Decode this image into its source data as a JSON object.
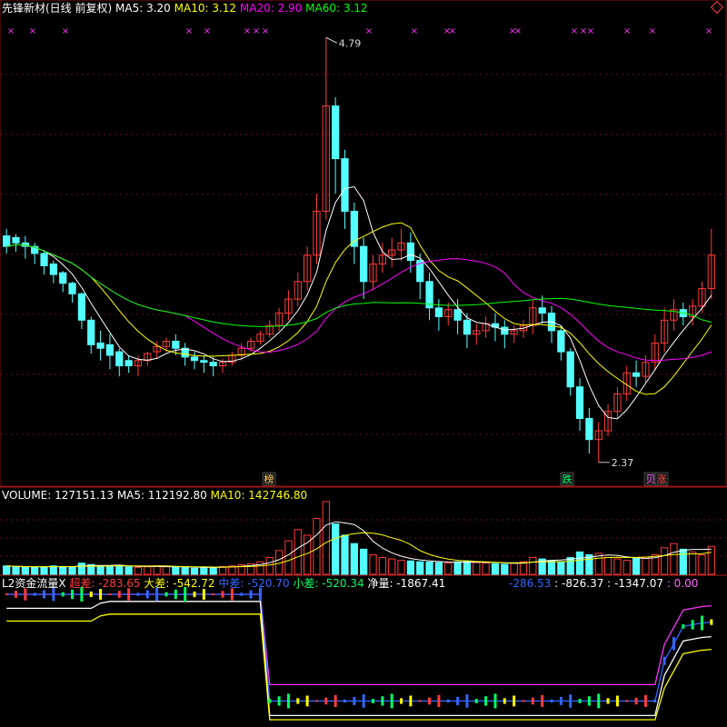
{
  "price_panel": {
    "stock_name": "先锋新材(日线 前复权)",
    "ma_labels": [
      {
        "text": "MA5: 3.20",
        "color": "#ffffff"
      },
      {
        "text": "MA10: 3.12",
        "color": "#ffff00"
      },
      {
        "text": "MA20: 2.90",
        "color": "#ff00ff"
      },
      {
        "text": "MA60: 3.12",
        "color": "#00ff00"
      }
    ],
    "high_label": "4.79",
    "low_label": "2.37",
    "tags": [
      {
        "text": "榜",
        "color": "#ffcc66"
      },
      {
        "text": "跌",
        "color": "#00ff66"
      },
      {
        "text": "贝",
        "color": "#ff66ff"
      },
      {
        "text": "涨",
        "color": "#ff4444"
      }
    ],
    "up_color": "#ff3b3b",
    "down_color": "#54ffff",
    "marker_icon": "x-mark-icon",
    "marker_color": "#ff33ff"
  },
  "volume_panel": {
    "title": "VOLUME: 127151.13",
    "ma_labels": [
      {
        "text": "MA5: 112192.80",
        "color": "#ffffff"
      },
      {
        "text": "MA10: 142746.80",
        "color": "#ffff00"
      }
    ]
  },
  "flow_panel": {
    "title": "L2资金流量X",
    "labels": [
      {
        "text": "超差: -283.65",
        "color": "#ff3b3b"
      },
      {
        "text": "大差: -542.72",
        "color": "#ffff00"
      },
      {
        "text": "中差: -520.70",
        "color": "#3366ff"
      },
      {
        "text": "小差: -520.34",
        "color": "#00ff66"
      },
      {
        "text": "净量: -1867.41",
        "color": "#ffffff"
      }
    ],
    "extra_labels": [
      {
        "text": "-286.53",
        "color": "#3366ff"
      },
      {
        "text": ": -826.37",
        "color": "#ffffff"
      },
      {
        "text": ": -1347.07",
        "color": "#ffffff"
      },
      {
        "text": ": 0.00",
        "color": "#ff66ff"
      }
    ]
  },
  "chart_data": {
    "type": "candlestick",
    "title": "先锋新材(日线 前复权)",
    "price_range": [
      2.37,
      4.79
    ],
    "candles": [
      [
        3.66,
        3.7,
        3.6,
        3.56
      ],
      [
        3.65,
        3.67,
        3.62,
        3.57
      ],
      [
        3.62,
        3.66,
        3.6,
        3.53
      ],
      [
        3.6,
        3.62,
        3.56,
        3.5
      ],
      [
        3.56,
        3.58,
        3.49,
        3.44
      ],
      [
        3.5,
        3.52,
        3.44,
        3.39
      ],
      [
        3.45,
        3.46,
        3.39,
        3.34
      ],
      [
        3.39,
        3.4,
        3.33,
        3.28
      ],
      [
        3.33,
        3.34,
        3.18,
        3.13
      ],
      [
        3.18,
        3.2,
        3.04,
        2.99
      ],
      [
        3.05,
        3.12,
        3.02,
        2.95
      ],
      [
        3.04,
        3.1,
        2.98,
        2.9
      ],
      [
        3.0,
        3.02,
        2.92,
        2.86
      ],
      [
        2.95,
        2.98,
        2.92,
        2.88
      ],
      [
        2.92,
        2.98,
        2.95,
        2.86
      ],
      [
        2.95,
        3.0,
        2.99,
        2.92
      ],
      [
        3.0,
        3.06,
        3.03,
        2.96
      ],
      [
        3.03,
        3.08,
        3.06,
        3.0
      ],
      [
        3.06,
        3.1,
        3.02,
        2.98
      ],
      [
        3.02,
        3.05,
        2.97,
        2.92
      ],
      [
        2.97,
        3.0,
        2.95,
        2.9
      ],
      [
        2.95,
        2.98,
        2.94,
        2.88
      ],
      [
        2.94,
        2.97,
        2.92,
        2.86
      ],
      [
        2.92,
        2.96,
        2.94,
        2.88
      ],
      [
        2.94,
        3.0,
        2.98,
        2.92
      ],
      [
        2.98,
        3.05,
        3.02,
        2.95
      ],
      [
        3.02,
        3.08,
        3.06,
        3.0
      ],
      [
        3.06,
        3.12,
        3.1,
        3.04
      ],
      [
        3.1,
        3.18,
        3.15,
        3.08
      ],
      [
        3.15,
        3.25,
        3.22,
        3.12
      ],
      [
        3.22,
        3.35,
        3.3,
        3.18
      ],
      [
        3.3,
        3.45,
        3.4,
        3.26
      ],
      [
        3.4,
        3.6,
        3.55,
        3.35
      ],
      [
        3.55,
        3.9,
        3.8,
        3.5
      ],
      [
        3.8,
        4.79,
        4.4,
        3.75
      ],
      [
        4.4,
        4.45,
        4.1,
        3.9
      ],
      [
        4.1,
        4.15,
        3.8,
        3.7
      ],
      [
        3.8,
        3.85,
        3.6,
        3.5
      ],
      [
        3.6,
        3.65,
        3.4,
        3.3
      ],
      [
        3.4,
        3.55,
        3.5,
        3.35
      ],
      [
        3.5,
        3.62,
        3.55,
        3.45
      ],
      [
        3.55,
        3.65,
        3.58,
        3.48
      ],
      [
        3.58,
        3.7,
        3.62,
        3.52
      ],
      [
        3.62,
        3.68,
        3.52,
        3.45
      ],
      [
        3.52,
        3.56,
        3.4,
        3.3
      ],
      [
        3.4,
        3.45,
        3.25,
        3.18
      ],
      [
        3.25,
        3.3,
        3.2,
        3.12
      ],
      [
        3.2,
        3.28,
        3.24,
        3.15
      ],
      [
        3.24,
        3.3,
        3.18,
        3.1
      ],
      [
        3.18,
        3.22,
        3.1,
        3.02
      ],
      [
        3.1,
        3.16,
        3.12,
        3.04
      ],
      [
        3.12,
        3.2,
        3.16,
        3.08
      ],
      [
        3.16,
        3.22,
        3.14,
        3.06
      ],
      [
        3.14,
        3.18,
        3.1,
        3.02
      ],
      [
        3.1,
        3.15,
        3.12,
        3.05
      ],
      [
        3.12,
        3.18,
        3.15,
        3.08
      ],
      [
        3.15,
        3.3,
        3.25,
        3.1
      ],
      [
        3.25,
        3.32,
        3.22,
        3.16
      ],
      [
        3.22,
        3.26,
        3.12,
        3.05
      ],
      [
        3.12,
        3.15,
        3.0,
        2.95
      ],
      [
        3.0,
        3.02,
        2.8,
        2.75
      ],
      [
        2.8,
        2.85,
        2.62,
        2.55
      ],
      [
        2.62,
        2.68,
        2.5,
        2.42
      ],
      [
        2.5,
        2.6,
        2.55,
        2.37
      ],
      [
        2.55,
        2.7,
        2.66,
        2.52
      ],
      [
        2.66,
        2.8,
        2.76,
        2.62
      ],
      [
        2.76,
        2.92,
        2.88,
        2.72
      ],
      [
        2.88,
        2.95,
        2.86,
        2.8
      ],
      [
        2.86,
        2.98,
        2.94,
        2.82
      ],
      [
        2.94,
        3.1,
        3.05,
        2.9
      ],
      [
        3.05,
        3.25,
        3.18,
        3.0
      ],
      [
        3.18,
        3.3,
        3.24,
        3.12
      ],
      [
        3.24,
        3.28,
        3.2,
        3.15
      ],
      [
        3.2,
        3.3,
        3.26,
        3.15
      ],
      [
        3.26,
        3.4,
        3.36,
        3.22
      ],
      [
        3.36,
        3.7,
        3.55,
        3.3
      ]
    ],
    "volume": [
      30,
      28,
      25,
      26,
      27,
      30,
      28,
      26,
      40,
      35,
      28,
      30,
      32,
      26,
      25,
      27,
      30,
      28,
      26,
      24,
      22,
      25,
      26,
      28,
      30,
      34,
      38,
      45,
      60,
      85,
      120,
      160,
      140,
      200,
      260,
      180,
      140,
      110,
      90,
      70,
      60,
      55,
      50,
      48,
      45,
      44,
      42,
      40,
      45,
      48,
      42,
      40,
      38,
      36,
      40,
      45,
      60,
      55,
      50,
      45,
      60,
      80,
      70,
      75,
      60,
      55,
      50,
      58,
      62,
      70,
      95,
      110,
      90,
      80,
      70,
      100
    ],
    "flow_net": [
      -620,
      -620,
      -620,
      -620,
      -620,
      -620,
      -620,
      -620,
      -620,
      -620,
      -560,
      -540,
      -540,
      -540,
      -540,
      -540,
      -540,
      -540,
      -540,
      -540,
      -540,
      -540,
      -540,
      -540,
      -540,
      -540,
      -540,
      -540,
      -1867,
      -1867,
      -1867,
      -1867,
      -1867,
      -1867,
      -1867,
      -1867,
      -1867,
      -1867,
      -1867,
      -1867,
      -1867,
      -1867,
      -1867,
      -1867,
      -1867,
      -1867,
      -1867,
      -1867,
      -1867,
      -1867,
      -1867,
      -1867,
      -1867,
      -1867,
      -1867,
      -1867,
      -1867,
      -1867,
      -1867,
      -1867,
      -1867,
      -1867,
      -1867,
      -1867,
      -1867,
      -1867,
      -1867,
      -1867,
      -1867,
      -1867,
      -1400,
      -1200,
      -1000,
      -980,
      -960,
      -950
    ]
  }
}
